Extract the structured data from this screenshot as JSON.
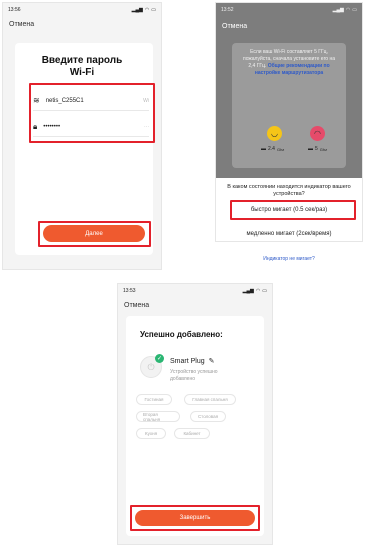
{
  "screen1": {
    "time": "13:56",
    "cancel": "Отмена",
    "title_line1": "Введите пароль",
    "title_line2": "Wi-Fi",
    "ssid": "netis_C255C1",
    "ssid_right": "Wi",
    "password": "••••••••",
    "password_right": "···",
    "next_button": "Далее"
  },
  "screen2": {
    "time": "13:52",
    "cancel": "Отмена",
    "info_text": "Если ваш Wi-Fi составляет 5 ГГц, пожалуйста, сначала установите его на 2,4 ГГц.",
    "info_link": "Общие рекомендации по настройке маршрутизатора",
    "speed_left": "2.4",
    "speed_left_unit": "Ghz",
    "speed_right": "5",
    "speed_right_unit": "Ghz",
    "question": "В каком состоянии находится индикатор вашего устройства?",
    "option_fast": "быстро мигает (0.5 сек/раз)",
    "option_slow": "медленно мигает (2сек/время)",
    "not_blinking_link": "Индикатор не мигает?"
  },
  "screen3": {
    "time": "13:53",
    "cancel": "Отмена",
    "heading": "Успешно добавлено:",
    "device_name": "Smart Plug",
    "device_status_1": "Устройство успешно",
    "device_status_2": "добавлено",
    "rooms": [
      "Гостиная",
      "Главная спальня",
      "Вторая спальня",
      "Столовая",
      "Кухня",
      "Кабинет"
    ],
    "finish_button": "Завершить"
  },
  "colors": {
    "accent": "#ef5a2f",
    "highlight": "#e3212b",
    "link": "#2e5ac9",
    "success": "#2bb673"
  }
}
